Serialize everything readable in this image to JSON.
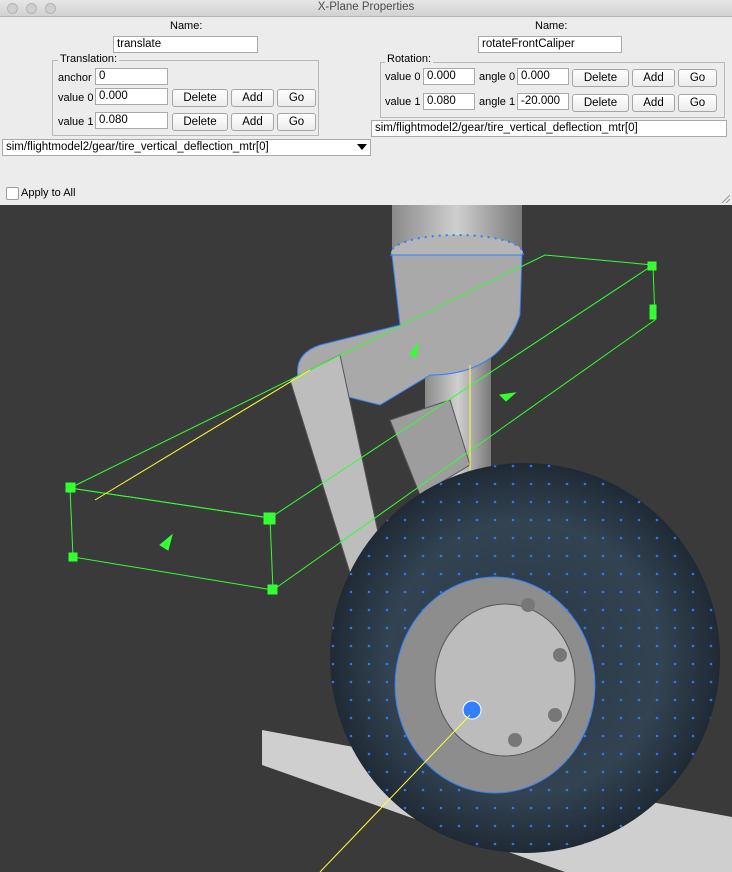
{
  "window": {
    "title": "X-Plane Properties"
  },
  "left": {
    "name_label": "Name:",
    "name_value": "translate",
    "group_title": "Translation:",
    "anchor_label": "anchor",
    "anchor_value": "0",
    "value0_label": "value 0",
    "value0": "0.000",
    "value1_label": "value 1",
    "value1": "0.080",
    "dataref": "sim/flightmodel2/gear/tire_vertical_deflection_mtr[0]"
  },
  "right": {
    "name_label": "Name:",
    "name_value": "rotateFrontCaliper",
    "group_title": "Rotation:",
    "value0_label": "value 0",
    "value0": "0.000",
    "angle0_label": "angle 0",
    "angle0": "0.000",
    "value1_label": "value 1",
    "value1": "0.080",
    "angle1_label": "angle 1",
    "angle1": "-20.000",
    "dataref": "sim/flightmodel2/gear/tire_vertical_deflection_mtr[0]"
  },
  "buttons": {
    "delete": "Delete",
    "add": "Add",
    "go": "Go"
  },
  "apply_to_all": "Apply to All",
  "colors": {
    "window_bg": "#ececec",
    "viewport_bg": "#3a3a3a",
    "manipulator": "#33ff33",
    "vertex": "#2f7fff",
    "axis": "#ffff33"
  },
  "viewport": {
    "icons": [
      "landing-gear-model",
      "wheel-model",
      "manipulator-box"
    ]
  }
}
